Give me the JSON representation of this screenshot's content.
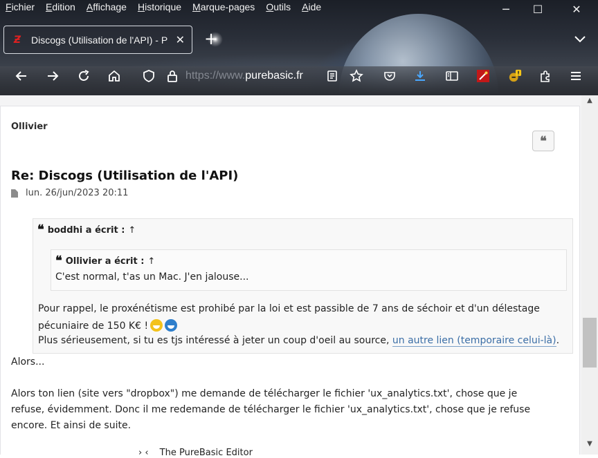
{
  "menu": [
    "Fichier",
    "Edition",
    "Affichage",
    "Historique",
    "Marque-pages",
    "Outils",
    "Aide"
  ],
  "menu_underline": [
    "F",
    "E",
    "A",
    "H",
    "M",
    "O",
    "A"
  ],
  "menu_rest": [
    "ichier",
    "dition",
    "ffichage",
    "istorique",
    "arque-pages",
    "utils",
    "ide"
  ],
  "window_controls": {
    "minimize": "─",
    "maximize": "☐",
    "close": "✕"
  },
  "tab": {
    "title": "Discogs (Utilisation de l'API) - P",
    "favicon": "Ƶ",
    "close": "✕"
  },
  "new_tab_symbol": "+",
  "url": {
    "protocol": "https://www.",
    "domain": "purebasic.fr"
  },
  "toolbar_icons": [
    "back-arrow-icon",
    "forward-arrow-icon",
    "reload-icon",
    "home-icon",
    "shield-icon",
    "lock-icon",
    "reader-view-icon",
    "bookmark-star-icon",
    "pocket-icon",
    "download-icon",
    "sidebar-icon",
    "extension-red-icon",
    "extension-alert-icon",
    "extensions-puzzle-icon",
    "hamburger-menu-icon"
  ],
  "post": {
    "author": "Ollivier",
    "quote_button": "❝",
    "title": "Re: Discogs (Utilisation de l'API)",
    "date": "lun. 26/jun/2023 20:11",
    "quote_outer": {
      "cite_name": "boddhi a écrit :",
      "cite_arrow": "↑",
      "inner": {
        "cite_name": "Ollivier a écrit :",
        "cite_arrow": "↑",
        "text": "C'est normal, t'as un Mac. J'en jalouse..."
      },
      "line1": "Pour rappel, le proxénétisme est prohibé par la loi et est passible de 7 ans de séchoir et d'un délestage",
      "line2": "pécuniaire de 150 K€ !",
      "line3_before": "Plus sérieusement, si tu es tjs intéressé à jeter un coup d'oeil au source, ",
      "line3_link": "un autre lien (temporaire celui-là)",
      "line3_after": "."
    },
    "body": [
      "Alors...",
      "Alors ton lien (site vers \"dropbox\") me demande de télécharger le fichier 'ux_analytics.txt', chose que je",
      "refuse, évidemment. Donc il me redemande de télécharger le fichier 'ux_analytics.txt', chose que je refuse",
      "encore. Et ainsi de suite."
    ]
  },
  "peek_text": "The PureBasic Editor",
  "peek_arrows": "›  ‹",
  "colors": {
    "link": "#3b6ea6",
    "page_bg": "#f4f4f5",
    "text": "#232323"
  }
}
